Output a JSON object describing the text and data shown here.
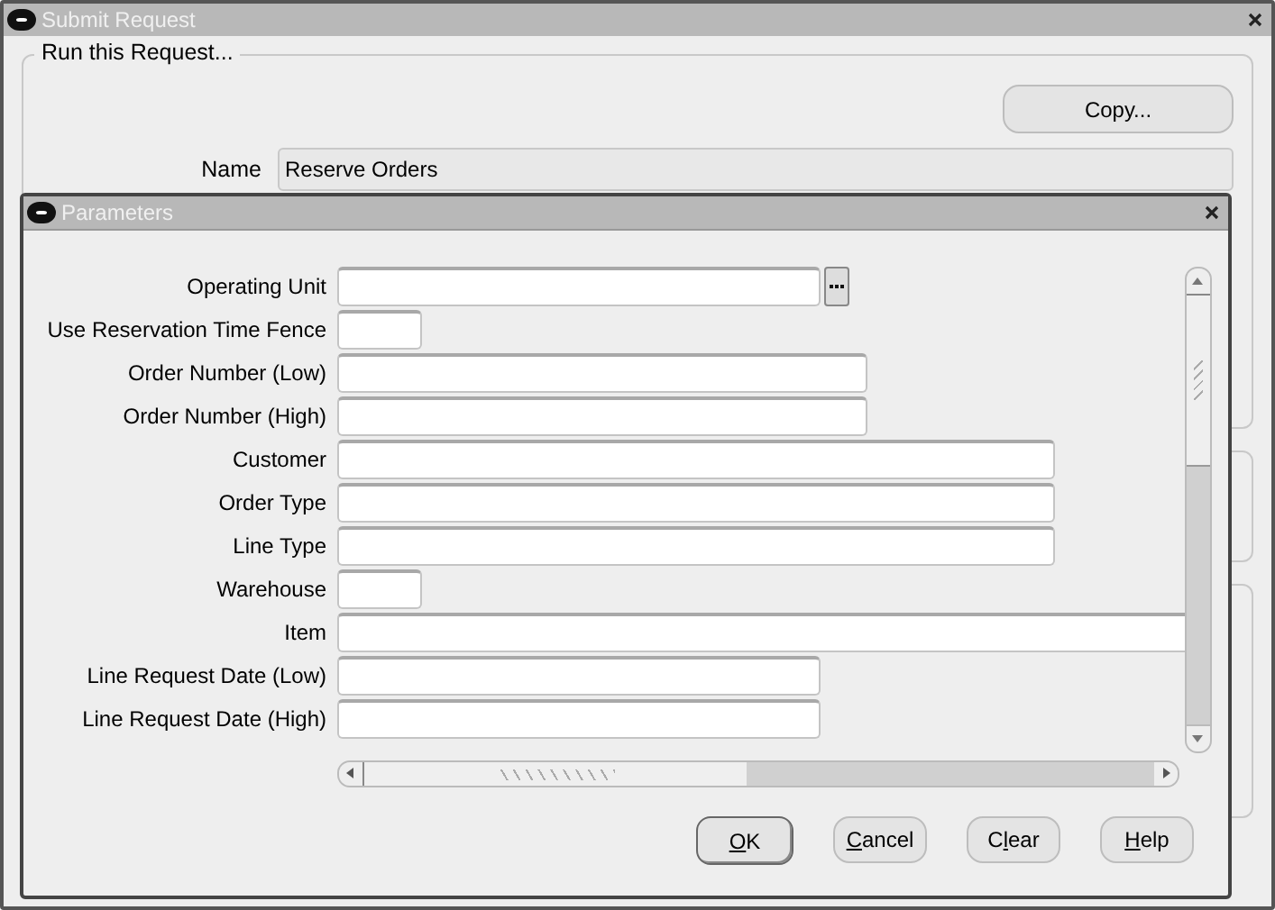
{
  "window": {
    "title": "Submit Request"
  },
  "request_group": {
    "title": "Run this Request..."
  },
  "copy_button": {
    "label": "Copy..."
  },
  "name_field": {
    "label": "Name",
    "value": "Reserve Orders"
  },
  "parameters": {
    "title": "Parameters",
    "fields": [
      {
        "label": "Operating Unit",
        "kind": "lov"
      },
      {
        "label": "Use Reservation Time Fence",
        "kind": "text"
      },
      {
        "label": "Order Number (Low)",
        "kind": "text"
      },
      {
        "label": "Order Number (High)",
        "kind": "text"
      },
      {
        "label": "Customer",
        "kind": "text"
      },
      {
        "label": "Order Type",
        "kind": "text"
      },
      {
        "label": "Line Type",
        "kind": "text"
      },
      {
        "label": "Warehouse",
        "kind": "text"
      },
      {
        "label": "Item",
        "kind": "text"
      },
      {
        "label": "Line Request Date (Low)",
        "kind": "text"
      },
      {
        "label": "Line Request Date (High)",
        "kind": "text"
      }
    ],
    "buttons": [
      {
        "key": "O",
        "after": "K",
        "default": true
      },
      {
        "key": "C",
        "after": "ancel",
        "default": false
      },
      {
        "before": "C",
        "key": "l",
        "after": "ear",
        "default": false
      },
      {
        "key": "H",
        "after": "elp",
        "default": false
      }
    ]
  }
}
